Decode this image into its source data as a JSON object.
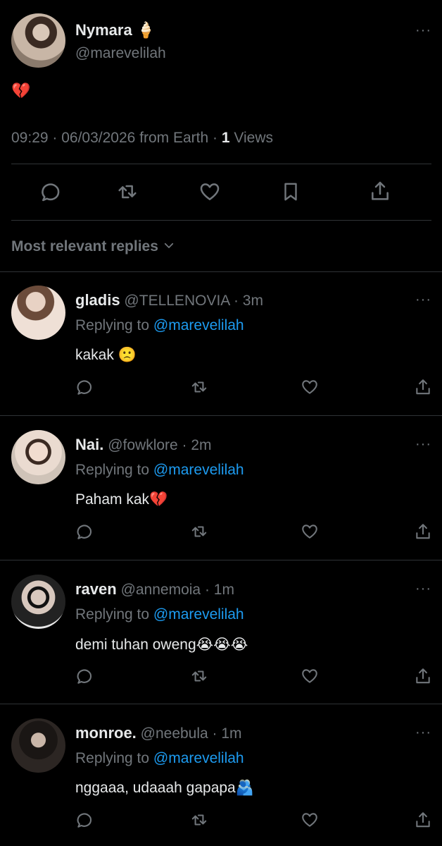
{
  "tweet": {
    "author_name": "Nymara",
    "author_name_emoji": "🍦",
    "author_handle": "@marevelilah",
    "text": "💔",
    "meta_time_date": "09:29 · 06/03/2026 from Earth · ",
    "views_count": "1",
    "views_label": " Views"
  },
  "replies_sort": {
    "label": "Most relevant replies"
  },
  "replies": [
    {
      "name": "gladis",
      "handle": "@TELLENOVIA",
      "time": " · 3m",
      "replying_prefix": "Replying to ",
      "replying_to": "@marevelilah",
      "text": "kakak 🙁"
    },
    {
      "name": "Nai.",
      "handle": "@fowklore",
      "time": " · 2m",
      "replying_prefix": "Replying to ",
      "replying_to": "@marevelilah",
      "text": "Paham kak💔"
    },
    {
      "name": "raven",
      "handle": "@annemoia",
      "time": " · 1m",
      "replying_prefix": "Replying to ",
      "replying_to": "@marevelilah",
      "text": "demi tuhan oweng😭😭😭"
    },
    {
      "name": "monroe.",
      "handle": "@neebula",
      "time": " · 1m",
      "replying_prefix": "Replying to ",
      "replying_to": "@marevelilah",
      "text": "nggaaa, udaaah gapapa🫂"
    }
  ],
  "colors": {
    "background": "#000000",
    "text": "#e7e9ea",
    "muted": "#71767b",
    "accent": "#1d9bf0",
    "divider": "#2f3336"
  },
  "icons": [
    "more-icon",
    "reply-icon",
    "retweet-icon",
    "like-icon",
    "bookmark-icon",
    "share-icon",
    "chevron-down-icon"
  ]
}
